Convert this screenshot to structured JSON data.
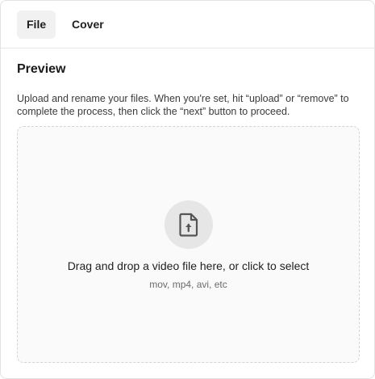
{
  "tabs": [
    {
      "label": "File",
      "active": true
    },
    {
      "label": "Cover",
      "active": false
    }
  ],
  "preview": {
    "title": "Preview",
    "description": "Upload and rename your files. When you're set, hit “upload” or “remove” to complete the process, then click the “next” button to proceed."
  },
  "dropzone": {
    "icon": "file-upload-icon",
    "main_text": "Drag and drop a video file here, or click to select",
    "sub_text": "mov, mp4, avi, etc"
  }
}
